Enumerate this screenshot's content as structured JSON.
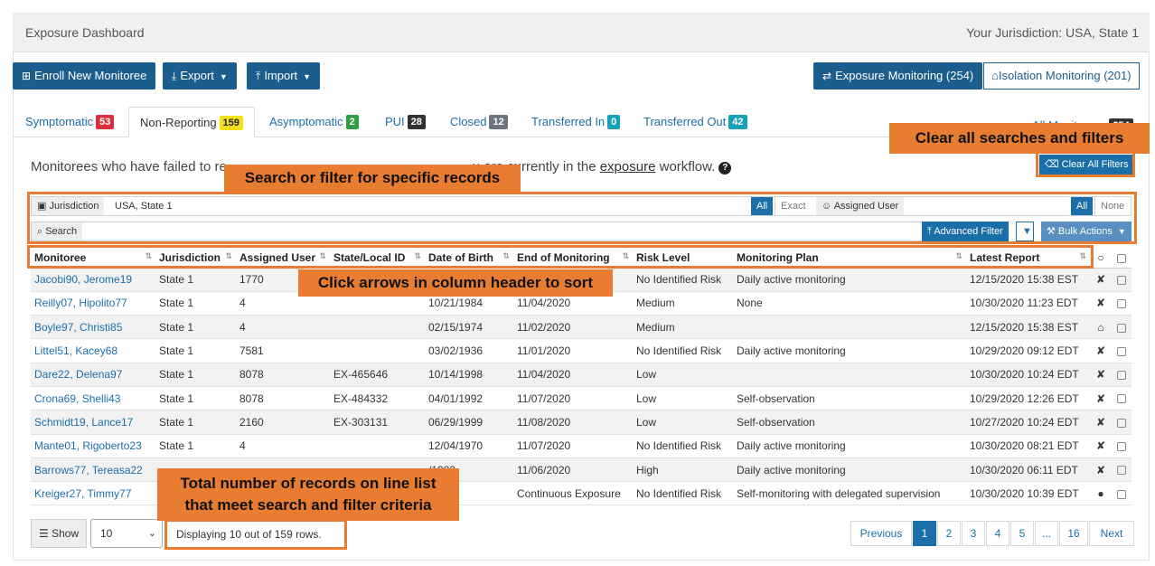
{
  "header": {
    "title": "Exposure Dashboard",
    "jurisdiction": "Your Jurisdiction: USA, State 1"
  },
  "toolbar": {
    "enroll": "Enroll New Monitoree",
    "export": "Export",
    "import": "Import",
    "exposure_monitoring": "Exposure Monitoring (254)",
    "isolation_monitoring": "Isolation Monitoring (201)"
  },
  "tabs": [
    {
      "label": "Symptomatic",
      "count": "53",
      "color": "#d9303b"
    },
    {
      "label": "Non-Reporting",
      "count": "159",
      "color": "#f2e11b"
    },
    {
      "label": "Asymptomatic",
      "count": "2",
      "color": "#2e9e45"
    },
    {
      "label": "PUI",
      "count": "28",
      "color": "#333333"
    },
    {
      "label": "Closed",
      "count": "12",
      "color": "#6c757d"
    },
    {
      "label": "Transferred In",
      "count": "0",
      "color": "#17a2b8"
    },
    {
      "label": "Transferred Out",
      "count": "42",
      "color": "#17a2b8"
    },
    {
      "label": "All Monitorees",
      "count": "254",
      "color": "#333333"
    }
  ],
  "description": {
    "pre": "Monitorees who have failed to re",
    "post": "u are currently in the",
    "link": "exposure",
    "end": "workflow."
  },
  "filters": {
    "jurisdiction_label": "Jurisdiction",
    "jurisdiction_value": "USA, State 1",
    "all": "All",
    "exact": "Exact",
    "assigned_user_label": "Assigned User",
    "none": "None",
    "search_label": "Search",
    "advanced_filter": "Advanced Filter",
    "bulk_actions": "Bulk Actions",
    "clear_all": "Clear All Filters"
  },
  "table": {
    "columns": [
      "Monitoree",
      "Jurisdiction",
      "Assigned User",
      "State/Local ID",
      "Date of Birth",
      "End of Monitoring",
      "Risk Level",
      "Monitoring Plan",
      "Latest Report"
    ],
    "rows": [
      {
        "name": "Jacobi90, Jerome19",
        "jur": "State 1",
        "user": "1770",
        "sid": "",
        "dob": "",
        "end": "",
        "risk": "No Identified Risk",
        "plan": "Daily active monitoring",
        "report": "12/15/2020 15:38 EST",
        "icon": "no-contact-icon"
      },
      {
        "name": "Reilly07, Hipolito77",
        "jur": "State 1",
        "user": "4",
        "sid": "",
        "dob": "10/21/1984",
        "end": "11/04/2020",
        "risk": "Medium",
        "plan": "None",
        "report": "10/30/2020 11:23 EDT",
        "icon": "no-contact-icon"
      },
      {
        "name": "Boyle97, Christi85",
        "jur": "State 1",
        "user": "4",
        "sid": "",
        "dob": "02/15/1974",
        "end": "11/02/2020",
        "risk": "Medium",
        "plan": "",
        "report": "12/15/2020 15:38 EST",
        "icon": "household-icon"
      },
      {
        "name": "Littel51, Kacey68",
        "jur": "State 1",
        "user": "7581",
        "sid": "",
        "dob": "03/02/1936",
        "end": "11/01/2020",
        "risk": "No Identified Risk",
        "plan": "Daily active monitoring",
        "report": "10/29/2020 09:12 EDT",
        "icon": "no-contact-icon"
      },
      {
        "name": "Dare22, Delena97",
        "jur": "State 1",
        "user": "8078",
        "sid": "EX-465646",
        "dob": "10/14/1998",
        "end": "11/04/2020",
        "risk": "Low",
        "plan": "",
        "report": "10/30/2020 10:24 EDT",
        "icon": "no-contact-icon"
      },
      {
        "name": "Crona69, Shelli43",
        "jur": "State 1",
        "user": "8078",
        "sid": "EX-484332",
        "dob": "04/01/1992",
        "end": "11/07/2020",
        "risk": "Low",
        "plan": "Self-observation",
        "report": "10/29/2020 12:26 EDT",
        "icon": "no-contact-icon"
      },
      {
        "name": "Schmidt19, Lance17",
        "jur": "State 1",
        "user": "2160",
        "sid": "EX-303131",
        "dob": "06/29/1999",
        "end": "11/08/2020",
        "risk": "Low",
        "plan": "Self-observation",
        "report": "10/27/2020 10:24 EDT",
        "icon": "no-contact-icon"
      },
      {
        "name": "Mante01, Rigoberto23",
        "jur": "State 1",
        "user": "4",
        "sid": "",
        "dob": "12/04/1970",
        "end": "11/07/2020",
        "risk": "No Identified Risk",
        "plan": "Daily active monitoring",
        "report": "10/30/2020 08:21 EDT",
        "icon": "no-contact-icon"
      },
      {
        "name": "Barrows77, Tereasa22",
        "jur": "",
        "user": "",
        "sid": "",
        "dob": "/1983",
        "end": "11/06/2020",
        "risk": "High",
        "plan": "Daily active monitoring",
        "report": "10/30/2020 06:11 EDT",
        "icon": "no-contact-icon"
      },
      {
        "name": "Kreiger27, Timmy77",
        "jur": "",
        "user": "",
        "sid": "",
        "dob": "/2004",
        "end": "Continuous Exposure",
        "risk": "No Identified Risk",
        "plan": "Self-monitoring with delegated supervision",
        "report": "10/30/2020 10:39 EDT",
        "icon": "comment-icon"
      }
    ]
  },
  "footer": {
    "show_label": "Show",
    "page_size": "10",
    "count_text": "Displaying 10 out of 159 rows.",
    "pages": [
      "Previous",
      "1",
      "2",
      "3",
      "4",
      "5",
      "...",
      "16",
      "Next"
    ]
  },
  "callouts": {
    "clear": "Clear all searches and filters",
    "search": "Search or filter for specific records",
    "sort": "Click arrows in column header to sort",
    "total_line1": "Total number of records on line list",
    "total_line2": "that meet search and filter criteria"
  },
  "colors": {
    "primary": "#1b5e8e",
    "link": "#1b6fa8",
    "callout": "#e87c30"
  }
}
